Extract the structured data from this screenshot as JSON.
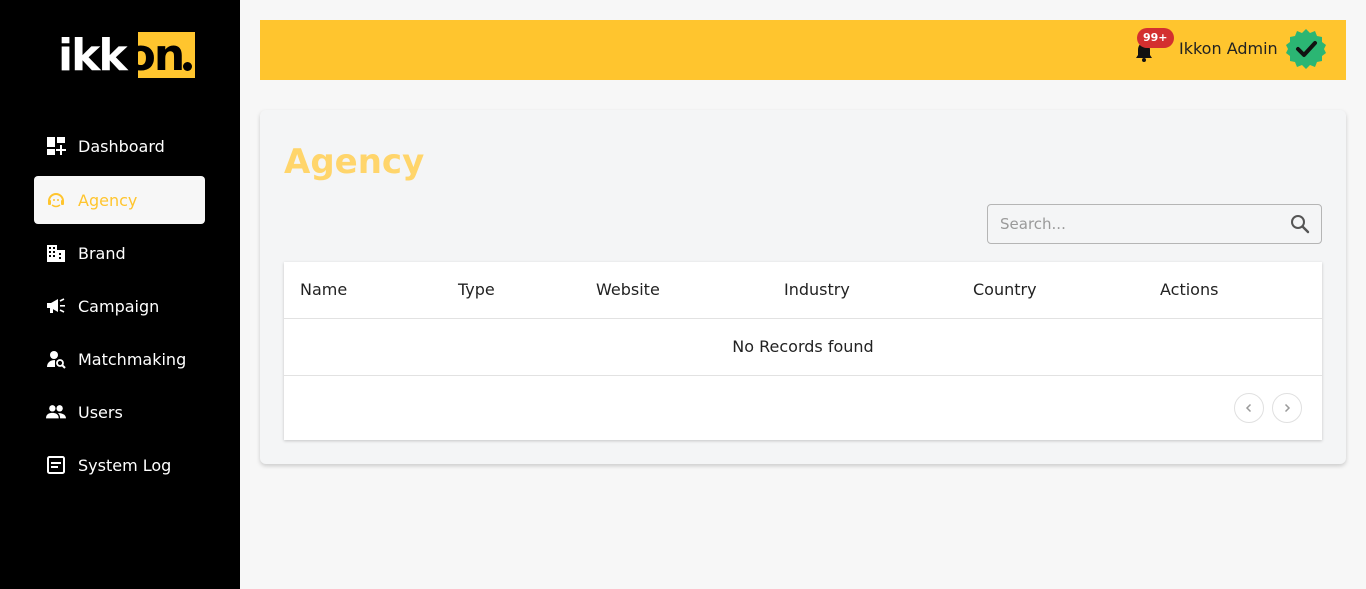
{
  "brand": {
    "logo_prefix": "ikk",
    "logo_suffix": "on"
  },
  "sidebar": {
    "items": [
      {
        "label": "Dashboard",
        "icon": "dashboard-icon"
      },
      {
        "label": "Agency",
        "icon": "agency-icon",
        "active": true
      },
      {
        "label": "Brand",
        "icon": "building-icon"
      },
      {
        "label": "Campaign",
        "icon": "megaphone-icon"
      },
      {
        "label": "Matchmaking",
        "icon": "person-search-icon"
      },
      {
        "label": "Users",
        "icon": "users-icon"
      },
      {
        "label": "System Log",
        "icon": "log-icon"
      }
    ]
  },
  "header": {
    "notification_count": "99+",
    "user_name": "Ikkon Admin"
  },
  "main": {
    "title": "Agency",
    "search": {
      "placeholder": "Search...",
      "value": ""
    },
    "table": {
      "columns": [
        "Name",
        "Type",
        "Website",
        "Industry",
        "Country",
        "Actions"
      ],
      "empty_message": "No Records found"
    }
  },
  "colors": {
    "accent": "#ffc52e",
    "sidebar_bg": "#000000",
    "badge": "#d32f2f",
    "verified": "#2bb673"
  }
}
